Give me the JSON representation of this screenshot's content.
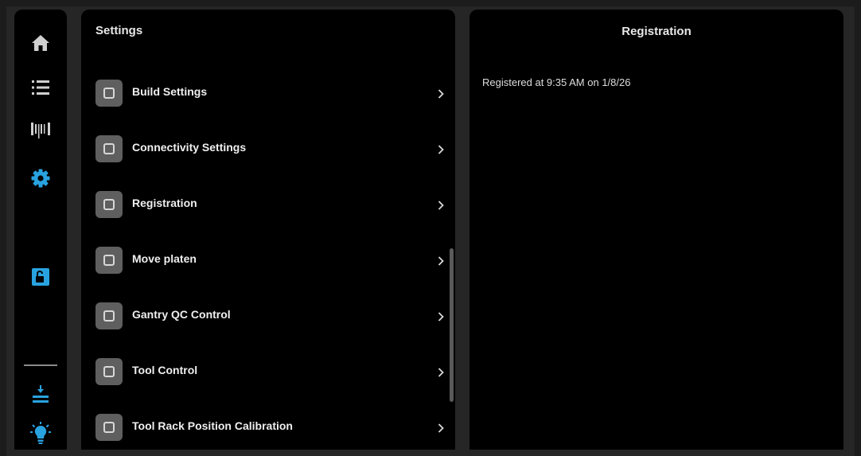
{
  "nav": {
    "items": [
      {
        "id": "home",
        "icon": "home-icon",
        "active": false
      },
      {
        "id": "list",
        "icon": "list-icon",
        "active": false
      },
      {
        "id": "barcode",
        "icon": "barcode-icon",
        "active": false
      },
      {
        "id": "settings",
        "icon": "gear-icon",
        "active": true
      },
      {
        "id": "lock",
        "icon": "lock-open-icon",
        "active": true
      }
    ],
    "bottom_items": [
      {
        "id": "platen",
        "icon": "platen-lower-icon"
      },
      {
        "id": "light",
        "icon": "lightbulb-icon"
      }
    ]
  },
  "settings": {
    "title": "Settings",
    "items": [
      {
        "label": "Build Settings"
      },
      {
        "label": "Connectivity Settings"
      },
      {
        "label": "Registration"
      },
      {
        "label": "Move platen"
      },
      {
        "label": "Gantry QC Control"
      },
      {
        "label": "Tool Control"
      },
      {
        "label": "Tool Rack Position Calibration"
      }
    ]
  },
  "detail": {
    "title": "Registration",
    "message": "Registered at 9:35 AM on 1/8/26"
  },
  "colors": {
    "accent": "#29a3e0",
    "icon_default": "#d0d0d0",
    "background": "#000000",
    "item_icon_bg": "#5f5f5f"
  }
}
